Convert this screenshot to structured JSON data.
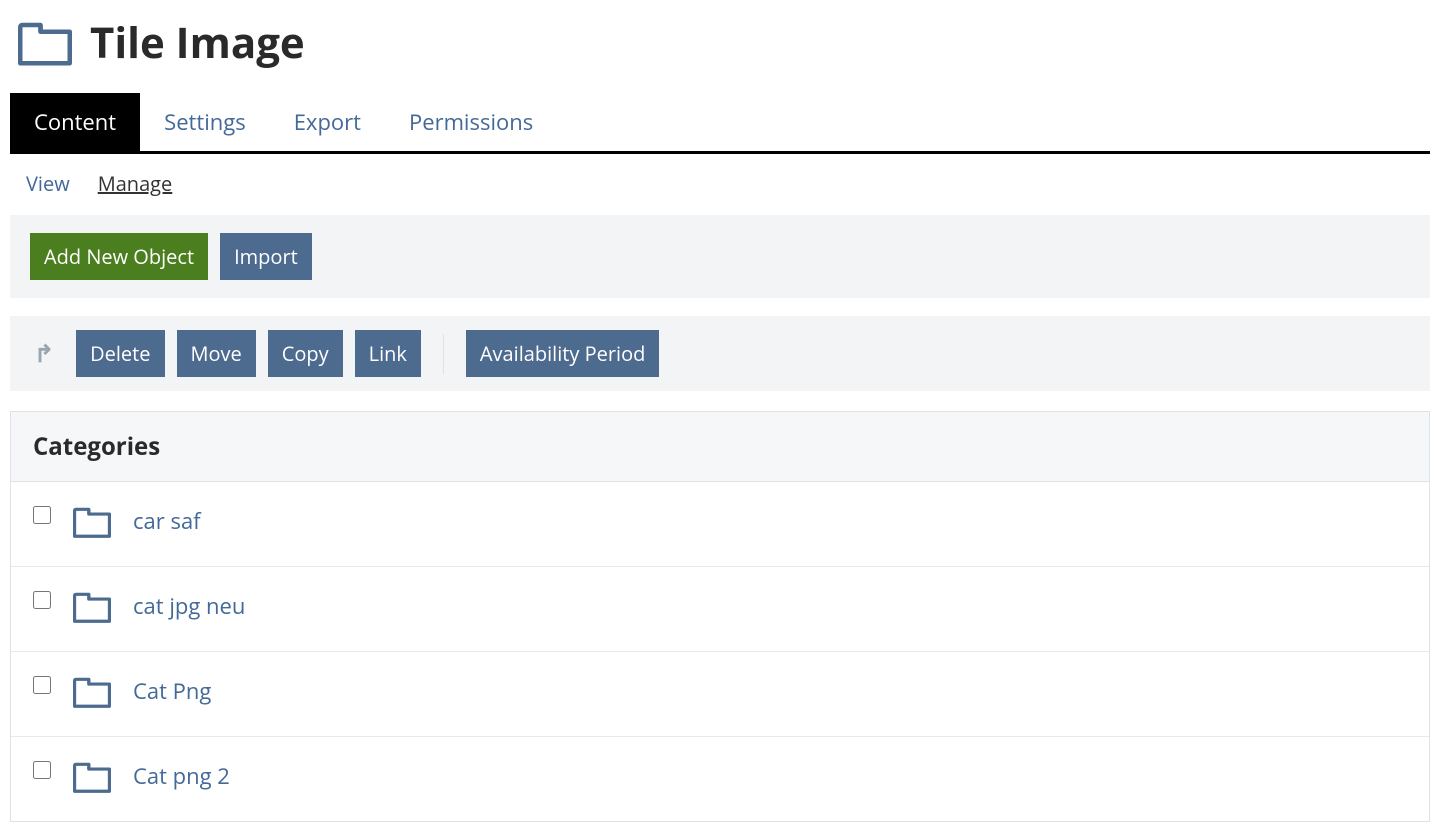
{
  "header": {
    "title": "Tile Image"
  },
  "tabs": {
    "content": "Content",
    "settings": "Settings",
    "export": "Export",
    "permissions": "Permissions"
  },
  "subtabs": {
    "view": "View",
    "manage": "Manage"
  },
  "toolbar": {
    "add_new": "Add New Object",
    "import": "Import"
  },
  "actions": {
    "delete": "Delete",
    "move": "Move",
    "copy": "Copy",
    "link": "Link",
    "availability": "Availability Period"
  },
  "panel": {
    "heading": "Categories",
    "items": [
      {
        "name": "car saf"
      },
      {
        "name": "cat jpg neu"
      },
      {
        "name": "Cat Png"
      },
      {
        "name": "Cat png 2"
      }
    ]
  }
}
